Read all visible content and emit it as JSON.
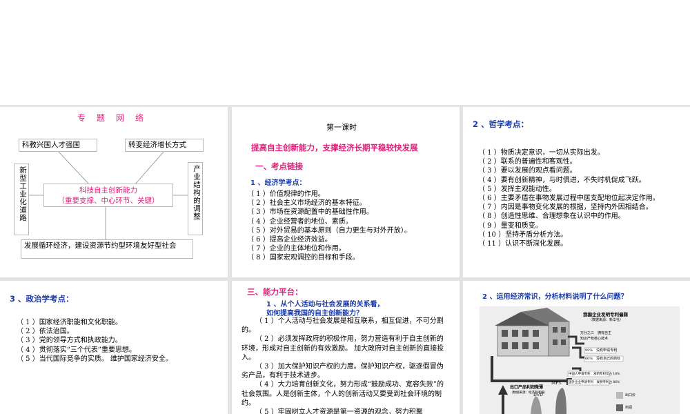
{
  "panel1": {
    "title": "专　题　网　络",
    "box_tl": "科教兴国人才强国",
    "box_tr": "转变经济增长方式",
    "box_left": "新型工业化道路",
    "box_right": "产业结构的调整",
    "center_line1": "科技自主创新能力",
    "center_line2": "（重要支撑、中心环节、关键）",
    "box_bottom": "发展循环经济，建设资源节约型环境友好型社会"
  },
  "panel2": {
    "lesson": "第一课时",
    "heading": "提高自主创新能力，支撑经济长期平稳较快发展",
    "section": "一、考点链接",
    "subsection": "1 、经济学考点：",
    "items": [
      "（ 1 ）价值规律的作用。",
      "（ 2 ）社会主义市场经济的基本特征。",
      "（ 3 ）市场在资源配置中的基础性作用。",
      "（ 4 ）企业经营者的地位、素质。",
      "（ 5 ）对外贸易的基本原则（自力更生与对外开放）。",
      "（ 6 ）提高企业经济效益。",
      "（ 7 ）企业的主体地位和作用。",
      "（ 8 ）国家宏观调控的目标和手段。"
    ]
  },
  "panel3": {
    "heading": "2 、哲学考点：",
    "items": [
      "（ 1 ）物质决定意识，一切从实际出发。",
      "（ 2 ）联系的普遍性和客观性。",
      "（ 3 ）要以发展的观点看问题。",
      "（ 4 ）要有创新精神，与时俱进，不失时机促成飞跃。",
      "（ 5 ）发挥主观能动性。",
      "（ 6 ）主要矛盾在事物发展过程中居支配地位起决定作用。",
      "（ 7 ）内因是事物变化发展的根据，坚持内外因相结合。",
      "（ 8 ）创造性思维、合理想象在认识中的作用。",
      "（ 9 ）量变和质变。",
      "（ 10 ）坚持矛盾分析方法。",
      "（ 11 ）认识不断深化发展。"
    ]
  },
  "panel4": {
    "heading": "3 、政治学考点：",
    "items": [
      "（ 1 ）国家经济职能和文化职能。",
      "（ 2 ）依法治国。",
      "（ 3 ）党的领导方式和执政能力。",
      "（ 4 ）贯彻落实“三个代表”重要思想。",
      "（ 5 ）当代国际竞争的实质。 维护国家经济安全。"
    ]
  },
  "panel5": {
    "section": "三、能力平台：",
    "q_line1": "1 、从个人活动与社会发展的关系看，",
    "q_line2": "如何提高我国的自主创新能力？",
    "paragraphs": [
      "（ 1 ）个人活动与社会发展是相互联系，相互促进，不可分割的。",
      "（ 2 ）必须发挥政府的积极作用，努力营造有利于自主创新的环境，形成对自主创新的有效激励。 加大政府对自主创新的直接投入。",
      "（ 3 ）加大保护知识产权的力度。保护知识产权，驱逐假冒伪劣产品，有利于技术进步。",
      "（ 4 ）大力培育创新文化，努力形成“鼓励成功、宽容失败”的社会氛围。人是创新主体，个人的创新活动又要受到社会环境的制约。",
      "（ 5 ）牢固树立人才资源是第一资源的观念，努力积聚"
    ]
  },
  "panel6": {
    "heading": "2 、运用经济常识，分析材料说明了什么问题？",
    "img_title": "我国企业发明专利偏弱",
    "img_subtitle": "（数据来源：新华社）",
    "img_label1": "万分之三　拥有自主",
    "img_label2": "知识产权核心技术",
    "img_label3": "99%　没有申请专利",
    "img_label4": "60%　没有自己的商标",
    "img_label5": "中国人申请专利　发明专利仅占 18%",
    "img_label6": "国外企业申请专利　发明专利占 86%",
    "img_bottom_title": "出口产品利润微薄",
    "img_bottom_sub": "（数据来源：经济参考报）",
    "img_mp3": "MP3",
    "img_dvd": "DVD",
    "legend1": "出口价",
    "legend2": "利润"
  }
}
